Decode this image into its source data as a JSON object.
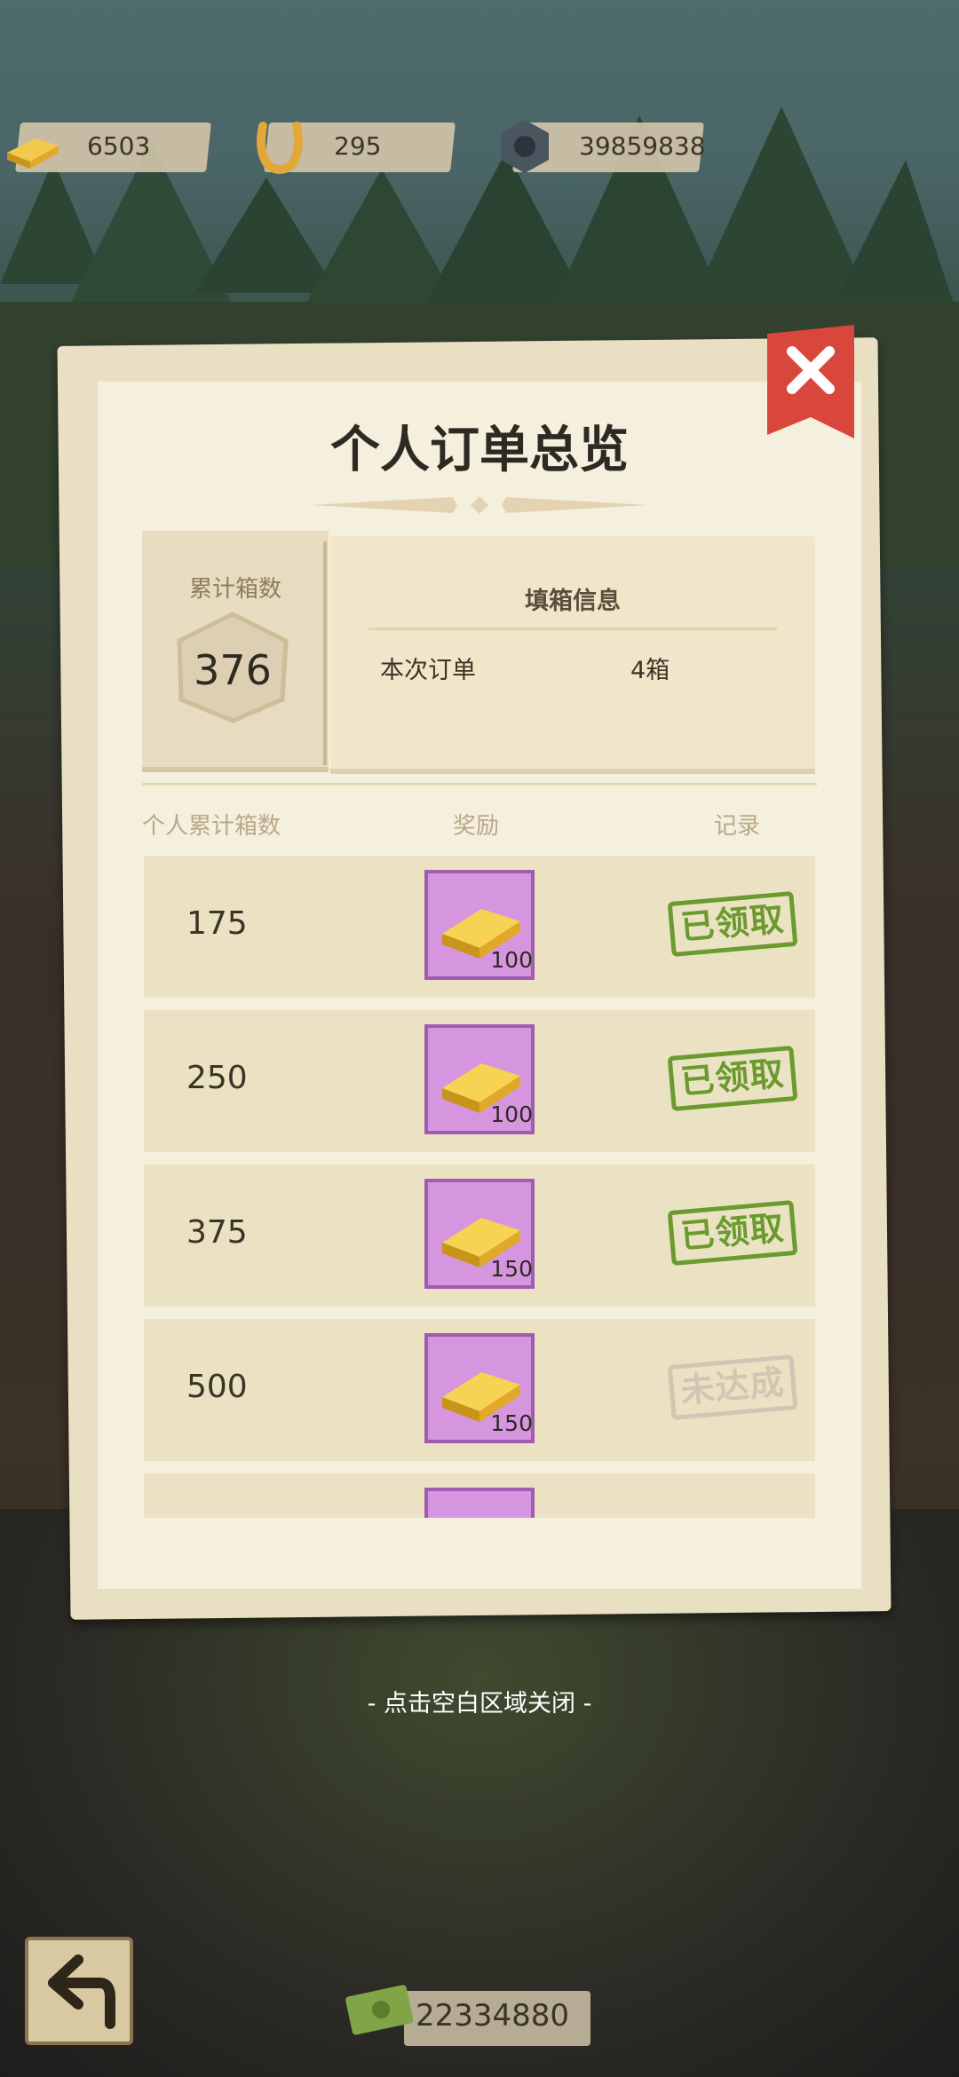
{
  "resources": [
    {
      "icon": "gold-bar-icon",
      "value": "6503"
    },
    {
      "icon": "horseshoe-icon",
      "value": "295"
    },
    {
      "icon": "nut-icon",
      "value": "39859838"
    }
  ],
  "modal": {
    "title": "个人订单总览",
    "accumulated_label": "累计箱数",
    "accumulated_value": "376",
    "fill_info_title": "填箱信息",
    "order_label": "本次订单",
    "order_value": "4箱",
    "columns": {
      "count": "个人累计箱数",
      "reward": "奖励",
      "record": "记录"
    },
    "rows": [
      {
        "count": "175",
        "reward_icon": "gold-bar-icon",
        "reward_qty": "100",
        "status": "已领取",
        "claimed": true
      },
      {
        "count": "250",
        "reward_icon": "gold-bar-icon",
        "reward_qty": "100",
        "status": "已领取",
        "claimed": true
      },
      {
        "count": "375",
        "reward_icon": "gold-bar-icon",
        "reward_qty": "150",
        "status": "已领取",
        "claimed": true
      },
      {
        "count": "500",
        "reward_icon": "gold-bar-icon",
        "reward_qty": "150",
        "status": "未达成",
        "claimed": false
      }
    ]
  },
  "hint": "- 点击空白区域关闭 -",
  "bottom_counter": "22334880",
  "colors": {
    "claimed": "#6b9a2f",
    "pending": "#cfc7b3",
    "reward_bg": "#d596df",
    "close": "#d9473c"
  }
}
